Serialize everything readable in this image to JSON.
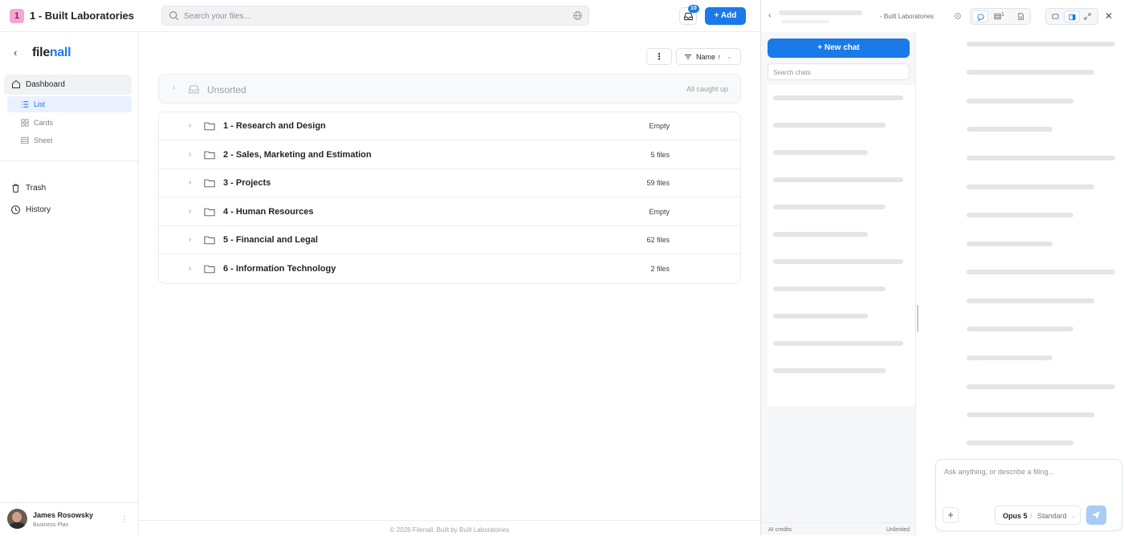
{
  "workspace": {
    "badge": "1",
    "name": "1 - Built Laboratories"
  },
  "search": {
    "placeholder": "Search your files..."
  },
  "inbox": {
    "count": "10"
  },
  "add_button": "+ Add",
  "sidebar": {
    "logo_part1": "file",
    "logo_part2": "nall",
    "dashboard": "Dashboard",
    "views": [
      "List",
      "Cards",
      "Sheet"
    ],
    "trash": "Trash",
    "history": "History"
  },
  "user": {
    "name": "James Rosowsky",
    "plan": "Business Plan"
  },
  "toolbar": {
    "sort_label": "Name ↑"
  },
  "unsorted": {
    "name": "Unsorted",
    "status": "All caught up"
  },
  "folders": [
    {
      "name": "1 - Research and Design",
      "count": "Empty"
    },
    {
      "name": "2 - Sales, Marketing and Estimation",
      "count": "5 files"
    },
    {
      "name": "3 - Projects",
      "count": "59 files"
    },
    {
      "name": "4 - Human Resources",
      "count": "Empty"
    },
    {
      "name": "5 - Financial and Legal",
      "count": "62 files"
    },
    {
      "name": "6 - Information Technology",
      "count": "2 files"
    }
  ],
  "footer": "© 2026 Filenall. Built by Built Laboratories",
  "chat": {
    "workspace_title": "- Built Laboratories",
    "tab_files_count": "1",
    "new_chat": "+ New chat",
    "search_placeholder": "Search chats",
    "credits_label": "AI credits",
    "credits_value": "Unlimited",
    "composer_placeholder": "Ask anything, or describe a filing...",
    "model_name": "Opus 5",
    "model_mode": "Standard"
  },
  "colors": {
    "accent": "#1a7ae8",
    "badge": "#f4a7cf"
  }
}
